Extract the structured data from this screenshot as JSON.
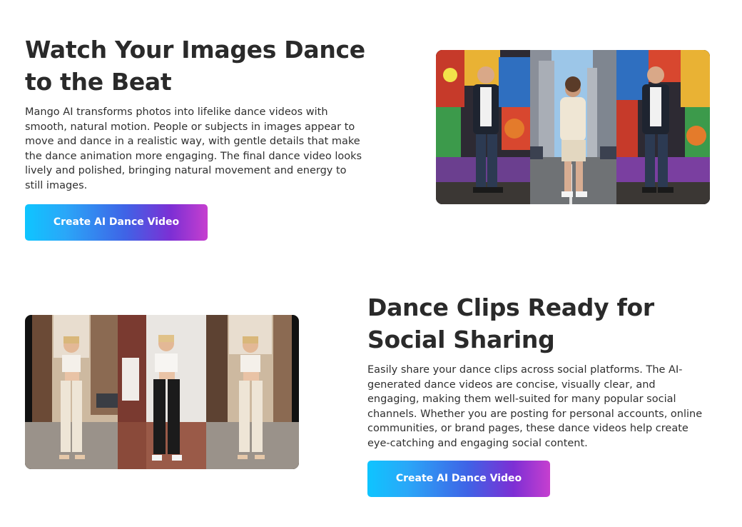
{
  "section1": {
    "heading": "Watch Your Images Dance to the Beat",
    "body": "Mango AI transforms photos into lifelike dance videos with smooth, natural motion. People or subjects in images appear to move and dance in a realistic way, with gentle details that make the dance animation more engaging. The final dance video looks lively and polished, bringing natural movement and energy to still images.",
    "cta_label": "Create AI Dance Video"
  },
  "section2": {
    "heading": "Dance Clips Ready for Social Sharing",
    "body": "Easily share your dance clips across social platforms. The AI-generated dance videos are concise, visually clear, and engaging, making them well-suited for many popular social channels. Whether you are posting for personal accounts, online communities, or brand pages, these dance videos help create eye-catching and engaging social content.",
    "cta_label": "Create AI Dance Video"
  },
  "colors": {
    "heading": "#2a2a2a",
    "body": "#2f2f2f",
    "cta_gradient_start": "#0ec5ff",
    "cta_gradient_end": "#c63fcf"
  }
}
